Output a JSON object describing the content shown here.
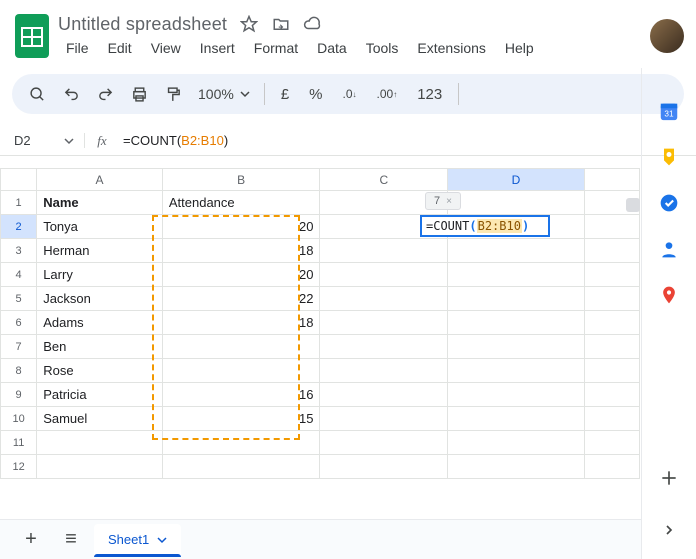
{
  "header": {
    "title": "Untitled spreadsheet",
    "menus": [
      "File",
      "Edit",
      "View",
      "Insert",
      "Format",
      "Data",
      "Tools",
      "Extensions",
      "Help"
    ]
  },
  "toolbar": {
    "zoom": "100%",
    "currency": "£",
    "percent": "%",
    "dec_dec": ".0",
    "inc_dec": ".00",
    "num_fmt": "123"
  },
  "namebox": "D2",
  "formula_prefix": "=COUNT",
  "formula_lparen": "(",
  "formula_range": "B2:B10",
  "formula_rparen": ")",
  "hint_value": "7",
  "hint_close": "×",
  "columns": [
    "A",
    "B",
    "C",
    "D"
  ],
  "rows": [
    {
      "n": "1",
      "A": "Name",
      "B": "Attendance"
    },
    {
      "n": "2",
      "A": "Tonya",
      "B": "20"
    },
    {
      "n": "3",
      "A": "Herman",
      "B": "18"
    },
    {
      "n": "4",
      "A": "Larry",
      "B": "20"
    },
    {
      "n": "5",
      "A": "Jackson",
      "B": "22"
    },
    {
      "n": "6",
      "A": "Adams",
      "B": "18"
    },
    {
      "n": "7",
      "A": "Ben",
      "B": ""
    },
    {
      "n": "8",
      "A": "Rose",
      "B": ""
    },
    {
      "n": "9",
      "A": "Patricia",
      "B": "16"
    },
    {
      "n": "10",
      "A": "Samuel",
      "B": "15"
    },
    {
      "n": "11",
      "A": "",
      "B": ""
    },
    {
      "n": "12",
      "A": "",
      "B": ""
    }
  ],
  "sheet_tab": "Sheet1"
}
